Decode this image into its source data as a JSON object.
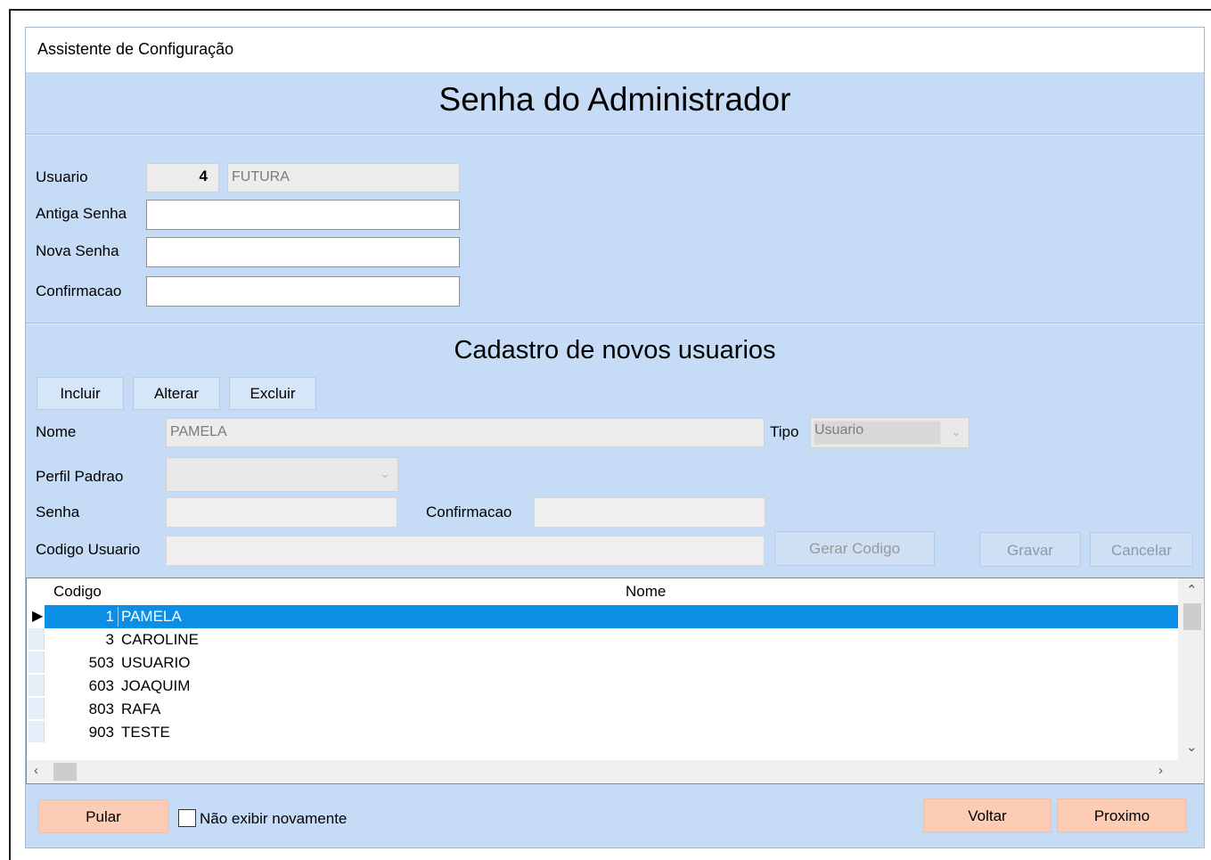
{
  "window": {
    "title": "Assistente de Configuração"
  },
  "admin": {
    "heading": "Senha do Administrador",
    "usuario_label": "Usuario",
    "usuario_code": "4",
    "usuario_name": "FUTURA",
    "antiga_label": "Antiga Senha",
    "nova_label": "Nova Senha",
    "confirm_label": "Confirmacao"
  },
  "cadastro": {
    "heading": "Cadastro de novos usuarios",
    "btn_incluir": "Incluir",
    "btn_alterar": "Alterar",
    "btn_excluir": "Excluir",
    "nome_label": "Nome",
    "nome_value": "PAMELA",
    "tipo_label": "Tipo",
    "tipo_value": "Usuario",
    "perfil_label": "Perfil Padrao",
    "senha_label": "Senha",
    "confirm_label": "Confirmacao",
    "codigo_label": "Codigo Usuario",
    "btn_gerar": "Gerar Codigo",
    "btn_gravar": "Gravar",
    "btn_cancelar": "Cancelar"
  },
  "grid": {
    "col_codigo": "Codigo",
    "col_nome": "Nome",
    "rows": [
      {
        "codigo": "1",
        "nome": "PAMELA",
        "selected": true
      },
      {
        "codigo": "3",
        "nome": "CAROLINE"
      },
      {
        "codigo": "503",
        "nome": "USUARIO"
      },
      {
        "codigo": "603",
        "nome": "JOAQUIM"
      },
      {
        "codigo": "803",
        "nome": "RAFA"
      },
      {
        "codigo": "903",
        "nome": "TESTE"
      }
    ]
  },
  "footer": {
    "btn_pular": "Pular",
    "checkbox_label": "Não exibir novamente",
    "btn_voltar": "Voltar",
    "btn_proximo": "Proximo"
  },
  "colors": {
    "panel_bg": "#c6dcf6",
    "selected_row": "#0b8fe6",
    "peach_button": "#fcccb5"
  }
}
